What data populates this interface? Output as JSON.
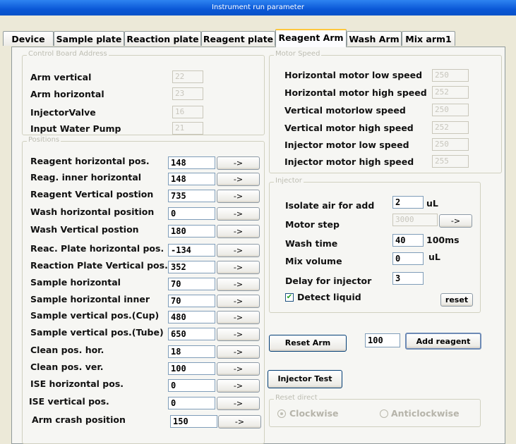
{
  "window": {
    "title": "Instrument run parameter"
  },
  "tabs": [
    "Device",
    "Sample plate",
    "Reaction plate",
    "Reagent plate",
    "Reagent Arm",
    "Wash Arm",
    "Mix arm1"
  ],
  "active_tab": "Reagent Arm",
  "control_board": {
    "title": "Control Board Address",
    "rows": [
      {
        "label": "Arm vertical",
        "value": "22"
      },
      {
        "label": "Arm horizontal",
        "value": "23"
      },
      {
        "label": "InjectorValve",
        "value": "16"
      },
      {
        "label": "Input Water Pump",
        "value": "21"
      }
    ]
  },
  "positions": {
    "title": "Positions",
    "arrow_label": "->",
    "rows": [
      {
        "label": "Reagent horizontal pos.",
        "value": "148"
      },
      {
        "label": "Reag. inner horizontal",
        "value": "148"
      },
      {
        "label": "Reagent Vertical  postion",
        "value": "735"
      },
      {
        "label": "Wash horizontal position",
        "value": "0"
      },
      {
        "label": "Wash Vertical postion",
        "value": "180"
      },
      {
        "label": "Reac. Plate horizontal pos.",
        "value": "-134"
      },
      {
        "label": "Reaction Plate Vertical pos.",
        "value": "352"
      },
      {
        "label": "Sample horizontal",
        "value": "70"
      },
      {
        "label": "Sample horizontal inner",
        "value": "70"
      },
      {
        "label": "Sample vertical pos.(Cup)",
        "value": "480"
      },
      {
        "label": "Sample vertical pos.(Tube)",
        "value": "650"
      },
      {
        "label": "Clean pos. hor.",
        "value": "18"
      },
      {
        "label": "Clean pos. ver.",
        "value": "100"
      },
      {
        "label": "ISE horizontal pos.",
        "value": "0"
      },
      {
        "label": "ISE vertical pos.",
        "value": "0"
      },
      {
        "label": "Arm crash position",
        "value": "150"
      }
    ]
  },
  "motor_speed": {
    "title": "Motor Speed",
    "rows": [
      {
        "label": "Horizontal motor low speed",
        "value": "250"
      },
      {
        "label": "Horizontal motor high speed",
        "value": "252"
      },
      {
        "label": "Vertical  motorlow speed",
        "value": "250"
      },
      {
        "label": "Vertical  motor high speed",
        "value": "252"
      },
      {
        "label": "Injector  motor low speed",
        "value": "250"
      },
      {
        "label": "Injector  motor high speed",
        "value": "255"
      }
    ]
  },
  "injector": {
    "title": "Injector",
    "isolate_air": {
      "label": "Isolate air for add",
      "value": "2",
      "unit": "uL"
    },
    "motor_step": {
      "label": "Motor step",
      "value": "3000",
      "button": "->"
    },
    "wash_time": {
      "label": "Wash time",
      "value": "40",
      "unit": "100ms"
    },
    "mix_volume": {
      "label": "Mix volume",
      "value": "0",
      "unit": "uL"
    },
    "delay": {
      "label": "Delay for injector",
      "value": "3"
    },
    "detect_liquid": {
      "label": "Detect liquid",
      "checked": true
    },
    "reset_button": "reset"
  },
  "actions": {
    "reset_arm": "Reset Arm",
    "reagent_amount": "100",
    "add_reagent": "Add reagent",
    "injector_test": "Injector Test"
  },
  "reset_direct": {
    "title": "Reset direct",
    "options": [
      "Clockwise",
      "Anticlockwise"
    ],
    "selected": "Clockwise"
  },
  "colors": {
    "title_bar": "#0a57d6",
    "active_tab_accent": "#ffc83c",
    "panel": "#f6f6f3",
    "disabled_text": "#c8c6bd"
  }
}
